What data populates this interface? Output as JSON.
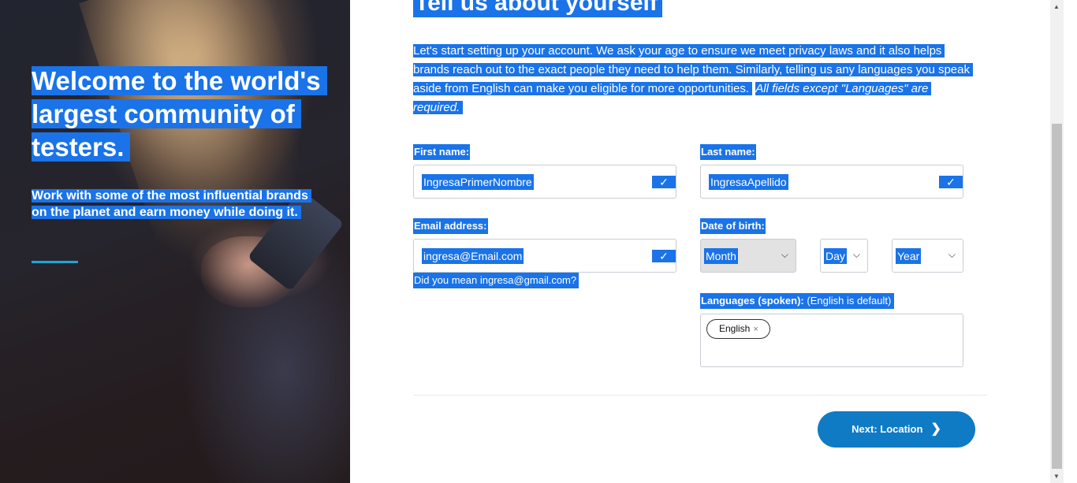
{
  "hero": {
    "title": "Welcome to the world's largest community of testers.",
    "subtitle": "Work with some of the most influential brands on the planet and earn money while doing it."
  },
  "form": {
    "heading": "Tell us about yourself",
    "intro": "Let's start setting up your account. We ask your age to ensure we meet privacy laws and it also helps brands reach out to the exact people they need to help them. Similarly, telling us any languages you speak aside from English can make you eligible for more opportunities.",
    "intro_note": "All fields except \"Languages\" are required.",
    "first_name_label": "First name:",
    "first_name_value": "IngresaPrimerNombre",
    "last_name_label": "Last name:",
    "last_name_value": "IngresaApellido",
    "email_label": "Email address:",
    "email_value": "ingresa@Email.com",
    "email_suggestion": "Did you mean ingresa@gmail.com?",
    "dob_label": "Date of birth:",
    "dob_month": "Month",
    "dob_day": "Day",
    "dob_year": "Year",
    "languages_label": "Languages (spoken):",
    "languages_note": "(English is default)",
    "language_chip": "English",
    "language_chip_remove": "×",
    "check_glyph": "✓",
    "next_label": "Next: Location"
  },
  "icons": {
    "check": "check-icon",
    "chevron_down": "chevron-down-icon",
    "chevron_right": "chevron-right-icon",
    "close": "close-icon"
  },
  "colors": {
    "selection": "#1a73e8",
    "button": "#0f7bc4",
    "accent_rule": "#1ea4d6"
  }
}
